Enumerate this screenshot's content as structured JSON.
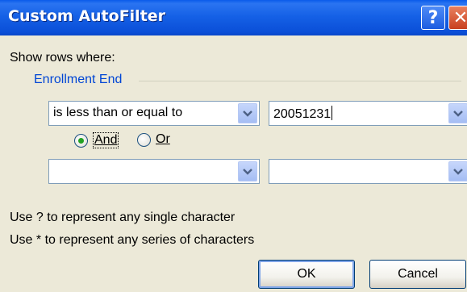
{
  "window": {
    "title": "Custom AutoFilter",
    "help_glyph": "?",
    "close_glyph": "✕"
  },
  "dialog": {
    "show_rows_label": "Show rows where:",
    "field_name": "Enrollment End",
    "criteria1": {
      "operator": "is less than or equal to",
      "value": "20051231"
    },
    "logic": {
      "and_label": "And",
      "or_label": "Or",
      "selected": "And"
    },
    "criteria2": {
      "operator": "",
      "value": ""
    },
    "hint_single": "Use ? to represent any single character",
    "hint_series": "Use * to represent any series of characters",
    "ok_label": "OK",
    "cancel_label": "Cancel"
  },
  "icons": [
    "help-icon",
    "close-icon",
    "chevron-down-icon"
  ]
}
